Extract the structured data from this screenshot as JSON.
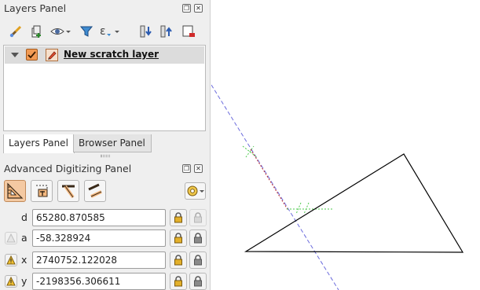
{
  "layers_panel": {
    "title": "Layers Panel",
    "toolbar_icons": [
      "style-brush-icon",
      "add-group-icon",
      "visibility-eye-icon",
      "filter-funnel-icon",
      "filter-expression-icon",
      "expand-all-icon",
      "collapse-all-icon",
      "remove-layer-icon"
    ],
    "layers": [
      {
        "name": "New scratch layer",
        "visible": true,
        "editable": true
      }
    ]
  },
  "tabs": [
    {
      "label": "Layers Panel",
      "active": true
    },
    {
      "label": "Browser Panel",
      "active": false
    }
  ],
  "adv_panel": {
    "title": "Advanced Digitizing Panel",
    "tools": [
      {
        "name": "enable-digitizing-tools",
        "active": true
      },
      {
        "name": "construction-mode",
        "active": false
      },
      {
        "name": "perpendicular",
        "active": false
      },
      {
        "name": "parallel",
        "active": false
      }
    ],
    "fields": [
      {
        "label": "d",
        "value": "65280.870585",
        "has_relative_toggle": false
      },
      {
        "label": "a",
        "value": "-58.328924",
        "has_relative_toggle": true
      },
      {
        "label": "x",
        "value": "2740752.122028",
        "has_relative_toggle": true
      },
      {
        "label": "y",
        "value": "-2198356.306611",
        "has_relative_toggle": true
      }
    ]
  },
  "colors": {
    "panel_bg": "#efefef",
    "accent_orange": "#f29b55",
    "guide_blue": "#6b6bdc",
    "guide_green": "#4cc94c",
    "construction_red": "#c03030",
    "polygon_stroke": "#000000"
  }
}
